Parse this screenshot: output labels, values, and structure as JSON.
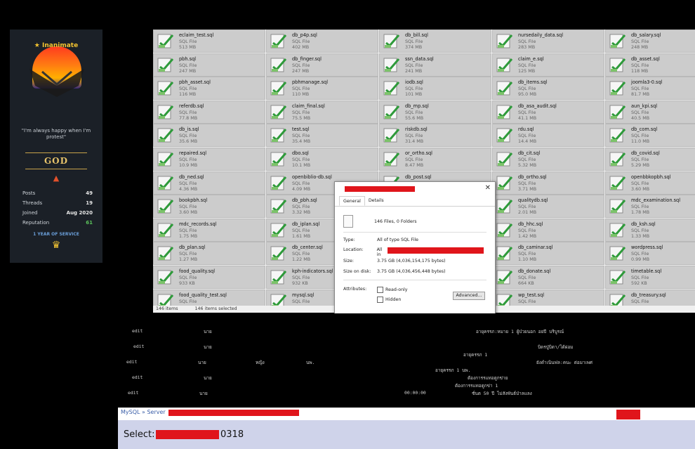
{
  "profile": {
    "rank_title": "★ Inanimate",
    "quote": "\"I'm always happy when I'm protest\"",
    "rank_badge": "GOD",
    "stats": [
      {
        "label": "Posts",
        "value": "49"
      },
      {
        "label": "Threads",
        "value": "19"
      },
      {
        "label": "Joined",
        "value": "Aug 2020"
      },
      {
        "label": "Reputation",
        "value": "61"
      }
    ],
    "service": "1 YEAR OF SERVICE"
  },
  "explorer": {
    "files": [
      {
        "name": "eclaim_test.sql",
        "type": "SQL File",
        "size": "513 MB"
      },
      {
        "name": "db_p4p.sql",
        "type": "SQL File",
        "size": "402 MB"
      },
      {
        "name": "db_bill.sql",
        "type": "SQL File",
        "size": "374 MB"
      },
      {
        "name": "nursedaily_data.sql",
        "type": "SQL File",
        "size": "283 MB"
      },
      {
        "name": "db_salary.sql",
        "type": "SQL File",
        "size": "248 MB"
      },
      {
        "name": "pbh.sql",
        "type": "SQL File",
        "size": "247 MB"
      },
      {
        "name": "db_finger.sql",
        "type": "SQL File",
        "size": "247 MB"
      },
      {
        "name": "ssn_data.sql",
        "type": "SQL File",
        "size": "241 MB"
      },
      {
        "name": "claim_e.sql",
        "type": "SQL File",
        "size": "125 MB"
      },
      {
        "name": "db_asset.sql",
        "type": "SQL File",
        "size": "118 MB"
      },
      {
        "name": "pbh_asset.sql",
        "type": "SQL File",
        "size": "116 MB"
      },
      {
        "name": "pbhmanage.sql",
        "type": "SQL File",
        "size": "110 MB"
      },
      {
        "name": "iodb.sql",
        "type": "SQL File",
        "size": "101 MB"
      },
      {
        "name": "db_items.sql",
        "type": "SQL File",
        "size": "95.0 MB"
      },
      {
        "name": "joomla3-0.sql",
        "type": "SQL File",
        "size": "81.7 MB"
      },
      {
        "name": "referdb.sql",
        "type": "SQL File",
        "size": "77.8 MB"
      },
      {
        "name": "claim_final.sql",
        "type": "SQL File",
        "size": "75.5 MB"
      },
      {
        "name": "db_mp.sql",
        "type": "SQL File",
        "size": "55.6 MB"
      },
      {
        "name": "db_asa_audit.sql",
        "type": "SQL File",
        "size": "41.1 MB"
      },
      {
        "name": "aun_kpi.sql",
        "type": "SQL File",
        "size": "40.5 MB"
      },
      {
        "name": "db_is.sql",
        "type": "SQL File",
        "size": "35.6 MB"
      },
      {
        "name": "test.sql",
        "type": "SQL File",
        "size": "35.4 MB"
      },
      {
        "name": "riskdb.sql",
        "type": "SQL File",
        "size": "31.4 MB"
      },
      {
        "name": "rdu.sql",
        "type": "SQL File",
        "size": "14.4 MB"
      },
      {
        "name": "db_com.sql",
        "type": "SQL File",
        "size": "11.0 MB"
      },
      {
        "name": "repaired.sql",
        "type": "SQL File",
        "size": "10.9 MB"
      },
      {
        "name": "dbo.sql",
        "type": "SQL File",
        "size": "10.1 MB"
      },
      {
        "name": "or_ortho.sql",
        "type": "SQL File",
        "size": "8.47 MB"
      },
      {
        "name": "db_cit.sql",
        "type": "SQL File",
        "size": "5.32 MB"
      },
      {
        "name": "db_covid.sql",
        "type": "SQL File",
        "size": "5.29 MB"
      },
      {
        "name": "db_ned.sql",
        "type": "SQL File",
        "size": "4.36 MB"
      },
      {
        "name": "openbiblio-db.sql",
        "type": "SQL File",
        "size": "4.09 MB"
      },
      {
        "name": "db_post.sql",
        "type": "SQL File",
        "size": ""
      },
      {
        "name": "db_ortho.sql",
        "type": "SQL File",
        "size": "3.71 MB"
      },
      {
        "name": "openbbkopbh.sql",
        "type": "SQL File",
        "size": "3.60 MB"
      },
      {
        "name": "bookpbh.sql",
        "type": "SQL File",
        "size": "3.60 MB"
      },
      {
        "name": "db_pbh.sql",
        "type": "SQL File",
        "size": "3.32 MB"
      },
      {
        "name": "",
        "type": "",
        "size": ""
      },
      {
        "name": "qualitydb.sql",
        "type": "SQL File",
        "size": "2.01 MB"
      },
      {
        "name": "mdc_examination.sql",
        "type": "SQL File",
        "size": "1.78 MB"
      },
      {
        "name": "mdc_records.sql",
        "type": "SQL File",
        "size": "1.75 MB"
      },
      {
        "name": "db_iplan.sql",
        "type": "SQL File",
        "size": "1.61 MB"
      },
      {
        "name": "",
        "type": "",
        "size": ""
      },
      {
        "name": "db_hhc.sql",
        "type": "SQL File",
        "size": "1.42 MB"
      },
      {
        "name": "db_ksh.sql",
        "type": "SQL File",
        "size": "1.33 MB"
      },
      {
        "name": "db_plan.sql",
        "type": "SQL File",
        "size": "1.27 MB"
      },
      {
        "name": "db_center.sql",
        "type": "SQL File",
        "size": "1.22 MB"
      },
      {
        "name": "",
        "type": "",
        "size": ""
      },
      {
        "name": "db_caminar.sql",
        "type": "SQL File",
        "size": "1.10 MB"
      },
      {
        "name": "wordpress.sql",
        "type": "SQL File",
        "size": "0.99 MB"
      },
      {
        "name": "food_quality.sql",
        "type": "SQL File",
        "size": "933 KB"
      },
      {
        "name": "kph-indicators.sql",
        "type": "SQL File",
        "size": "932 KB"
      },
      {
        "name": "",
        "type": "",
        "size": ""
      },
      {
        "name": "db_donate.sql",
        "type": "SQL File",
        "size": "664 KB"
      },
      {
        "name": "timetable.sql",
        "type": "SQL File",
        "size": "592 KB"
      },
      {
        "name": "food_quality_test.sql",
        "type": "SQL File",
        "size": ""
      },
      {
        "name": "mysql.sql",
        "type": "SQL File",
        "size": ""
      },
      {
        "name": "",
        "type": "",
        "size": ""
      },
      {
        "name": "wp_test.sql",
        "type": "SQL File",
        "size": ""
      },
      {
        "name": "db_treasury.sql",
        "type": "SQL File",
        "size": ""
      }
    ],
    "status_count": "146 items",
    "status_selected": "146 items selected"
  },
  "dialog": {
    "tab_general": "General",
    "tab_details": "Details",
    "summary": "146 Files, 0 Folders",
    "type_label": "Type:",
    "type_value": "All of type SQL File",
    "location_label": "Location:",
    "location_prefix": "All in",
    "size_label": "Size:",
    "size_value": "3.75 GB (4,036,154,175 bytes)",
    "size_disk_label": "Size on disk:",
    "size_disk_value": "3.75 GB (4,036,456,448 bytes)",
    "attributes_label": "Attributes:",
    "readonly_label": "Read-only",
    "hidden_label": "Hidden",
    "advanced_label": "Advanced...",
    "close_glyph": "✕"
  },
  "table": {
    "rows": [
      {
        "edit": "edit",
        "c1": "นาย",
        "c2": "อายุครรภ:หมาย 1 ผู้ป่วยนอก อยปี บริบูรณ์"
      },
      {
        "edit": "edit",
        "c1": "นาย",
        "c2": "บิดรปู่บิดา/ได้ผ่อม"
      },
      {
        "edit": "edit",
        "c1": "นาย",
        "c2": "ยังดำเนินฟล:คนะ ต่อมาเพศ"
      },
      {
        "edit": "edit",
        "c1": "นาย",
        "c2": "ต้องการรแทอดูกข่าย"
      },
      {
        "edit": "edit",
        "c1": "นาย",
        "c2": "ชั่นต 50 ปี ไม่สังพันธ์ป่าลแลง"
      }
    ],
    "sub1": "อายุครรภ 1",
    "sub2": "อายุครรภ 1 นพ.",
    "sub3": "ต้องการรแทอดูกข่า 1",
    "time": "00:00:00",
    "extra1": "หญิง",
    "extra2": "นพ."
  },
  "mysql": {
    "label": "MySQL » Server",
    "select_label": "Select:",
    "select_value": "0318"
  }
}
